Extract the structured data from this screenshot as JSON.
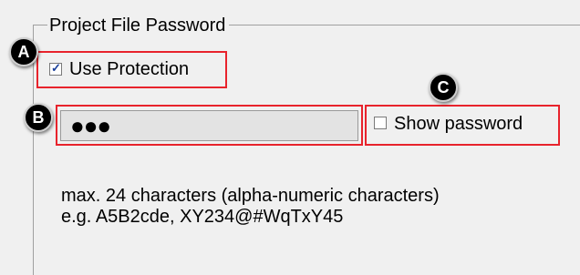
{
  "group": {
    "title": "Project File Password"
  },
  "protection": {
    "label": "Use Protection",
    "checked": true
  },
  "password": {
    "value": "●●●"
  },
  "show_password": {
    "label": "Show password",
    "checked": false
  },
  "help": {
    "line1": "max. 24 characters (alpha-numeric characters)",
    "line2": "e.g. A5B2cde, XY234@#WqTxY45"
  },
  "markers": {
    "a": "A",
    "b": "B",
    "c": "C"
  },
  "colors": {
    "callout": "#e8232c",
    "panel": "#f0f0f0"
  }
}
